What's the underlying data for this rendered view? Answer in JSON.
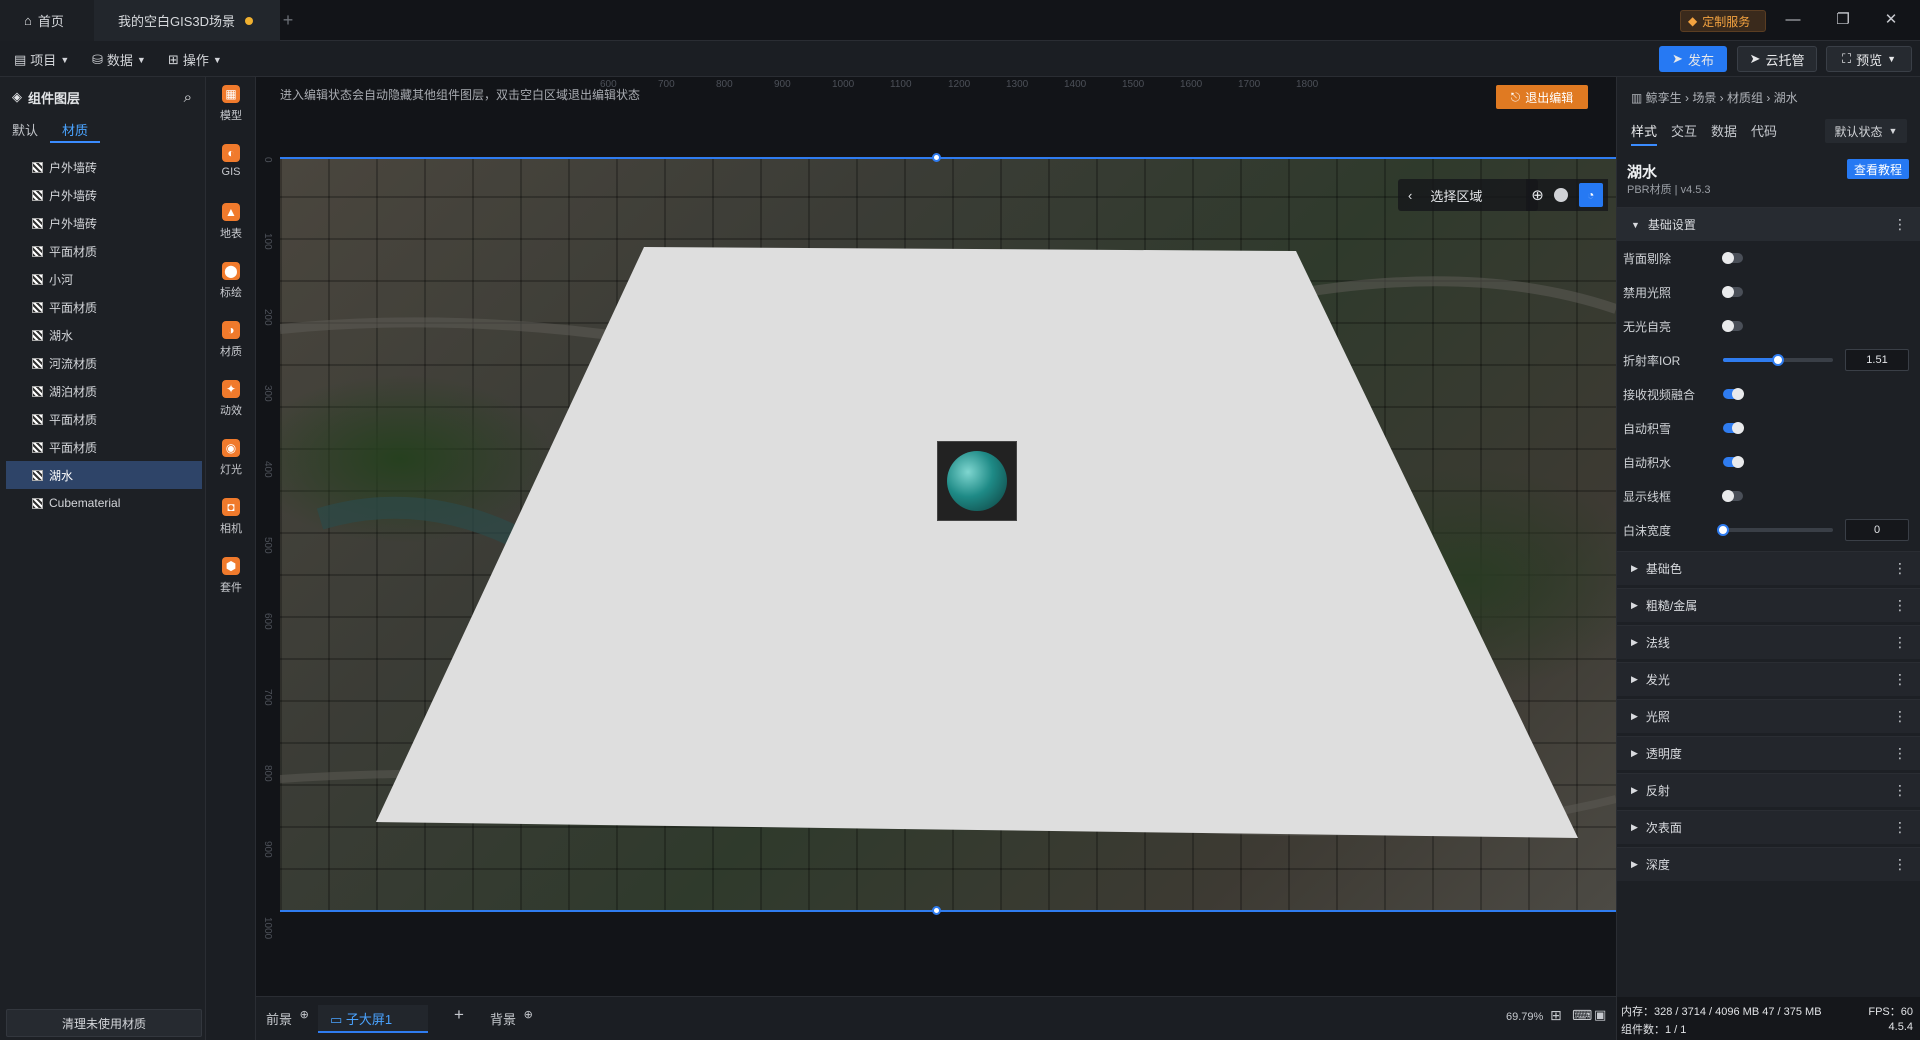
{
  "titlebar": {
    "home_tab": "首页",
    "scene_tab": "我的空白GIS3D场景",
    "custom_service": "定制服务",
    "minimize": "—",
    "restore": "❐",
    "close": "✕"
  },
  "toolbar": {
    "menus": [
      "项目",
      "数据",
      "操作"
    ],
    "publish": "发布",
    "cloud": "云托管",
    "preview": "预览"
  },
  "left_panel": {
    "title": "组件图层",
    "tabs": [
      "默认",
      "材质"
    ],
    "active_tab": 1,
    "layers": [
      "户外墙砖",
      "户外墙砖",
      "户外墙砖",
      "平面材质",
      "小河",
      "平面材质",
      "湖水",
      "河流材质",
      "湖泊材质",
      "平面材质",
      "平面材质",
      "湖水",
      "Cubematerial"
    ],
    "selected_index": 11,
    "clear_button": "清理未使用材质"
  },
  "icon_bar": [
    {
      "label": "模型",
      "color": "#f07a2c"
    },
    {
      "label": "GIS",
      "color": "#f07a2c"
    },
    {
      "label": "地表",
      "color": "#f07a2c"
    },
    {
      "label": "标绘",
      "color": "#f07a2c"
    },
    {
      "label": "材质",
      "color": "#f07a2c"
    },
    {
      "label": "动效",
      "color": "#f07a2c"
    },
    {
      "label": "灯光",
      "color": "#f07a2c"
    },
    {
      "label": "相机",
      "color": "#f07a2c"
    },
    {
      "label": "套件",
      "color": "#f07a2c"
    }
  ],
  "canvas": {
    "hint": "进入编辑状态会自动隐藏其他组件图层，双击空白区域退出编辑状态",
    "exit_edit": "退出编辑",
    "select_area": "选择区域",
    "ruler_top": [
      "600",
      "700",
      "800",
      "900",
      "1000",
      "1100",
      "1200",
      "1300",
      "1400",
      "1500",
      "1600",
      "1700",
      "1800"
    ],
    "ruler_left": [
      "0",
      "100",
      "200",
      "300",
      "400",
      "500",
      "600",
      "700",
      "800",
      "900",
      "1000"
    ]
  },
  "bottom_bar": {
    "tabs": [
      "前景",
      "子大屏1",
      "背景"
    ],
    "add": "+",
    "zoom": "69.79%"
  },
  "right_panel": {
    "breadcrumb": "鲸孪生 › 场景 › 材质组 › 湖水",
    "tabs": [
      "样式",
      "交互",
      "数据",
      "代码"
    ],
    "state": "默认状态",
    "material_name": "湖水",
    "material_type": "PBR材质 | v4.5.3",
    "tutorial": "查看教程",
    "section_basic": "基础设置",
    "props": [
      {
        "label": "背面剔除",
        "type": "toggle",
        "on": false
      },
      {
        "label": "禁用光照",
        "type": "toggle",
        "on": false
      },
      {
        "label": "无光自亮",
        "type": "toggle",
        "on": false
      },
      {
        "label": "折射率IOR",
        "type": "slider",
        "fraction": 0.5,
        "value": "1.51"
      },
      {
        "label": "接收视频融合",
        "type": "toggle",
        "on": true
      },
      {
        "label": "自动积雪",
        "type": "toggle",
        "on": true
      },
      {
        "label": "自动积水",
        "type": "toggle",
        "on": true
      },
      {
        "label": "显示线框",
        "type": "toggle",
        "on": false
      },
      {
        "label": "白沫宽度",
        "type": "slider",
        "fraction": 0.0,
        "value": "0"
      }
    ],
    "sections": [
      "基础色",
      "粗糙/金属",
      "法线",
      "发光",
      "光照",
      "透明度",
      "反射",
      "次表面",
      "深度"
    ],
    "stats": {
      "memory": "内存：328 / 3714 / 4096 MB  47 / 375 MB",
      "fps": "FPS：60",
      "components": "组件数：1 / 1",
      "version": "4.5.4"
    }
  }
}
